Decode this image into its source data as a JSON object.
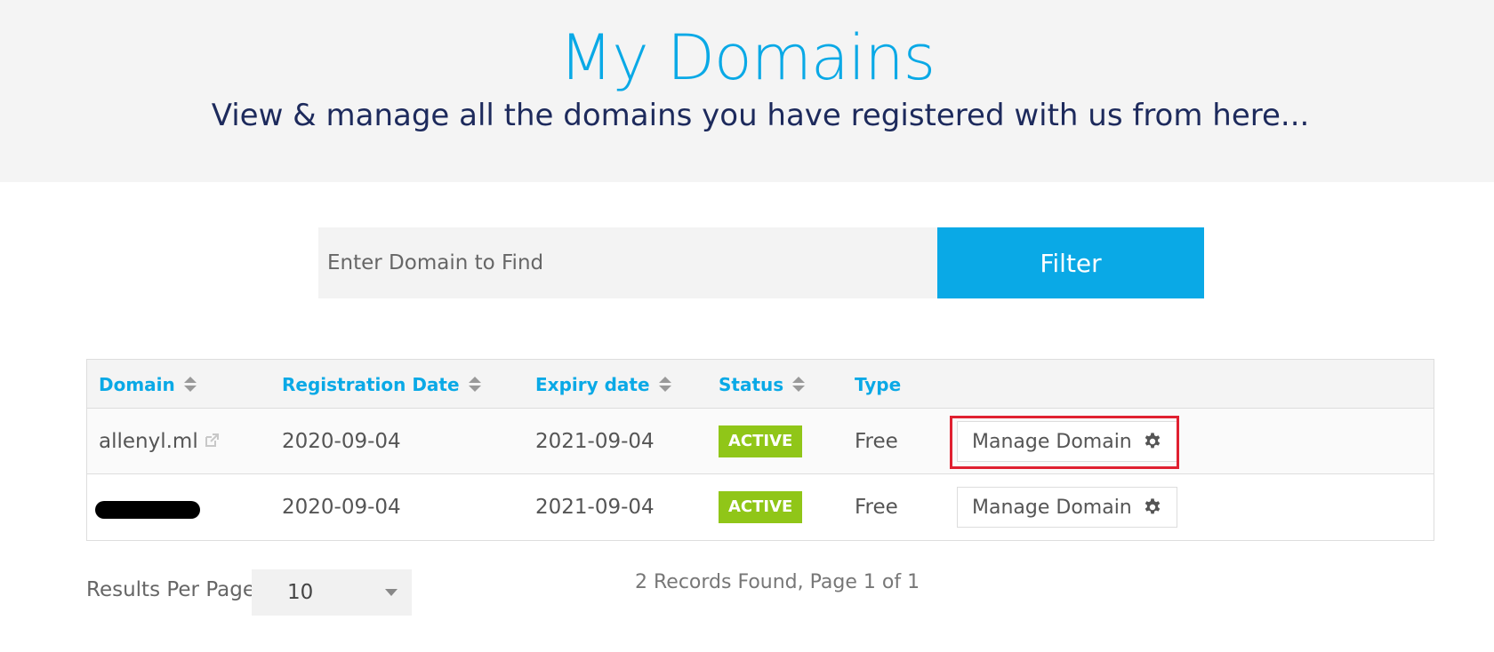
{
  "header": {
    "title": "My Domains",
    "subtitle": "View & manage all the domains you have registered with us from here..."
  },
  "search": {
    "placeholder": "Enter Domain to Find",
    "button_label": "Filter"
  },
  "table": {
    "columns": [
      "Domain",
      "Registration Date",
      "Expiry date",
      "Status",
      "Type"
    ],
    "rows": [
      {
        "domain": "allenyl.ml",
        "registration_date": "2020-09-04",
        "expiry_date": "2021-09-04",
        "status": "ACTIVE",
        "type": "Free",
        "action": "Manage Domain"
      },
      {
        "domain": "",
        "registration_date": "2020-09-04",
        "expiry_date": "2021-09-04",
        "status": "ACTIVE",
        "type": "Free",
        "action": "Manage Domain"
      }
    ]
  },
  "footer": {
    "results_per_page_label": "Results Per Page:",
    "results_per_page_value": "10",
    "records_info": "2 Records Found, Page 1 of 1"
  },
  "colors": {
    "accent": "#0aa9e6",
    "subtitle": "#1d2a5c",
    "active_badge": "#90c618",
    "highlight": "#e02030"
  }
}
